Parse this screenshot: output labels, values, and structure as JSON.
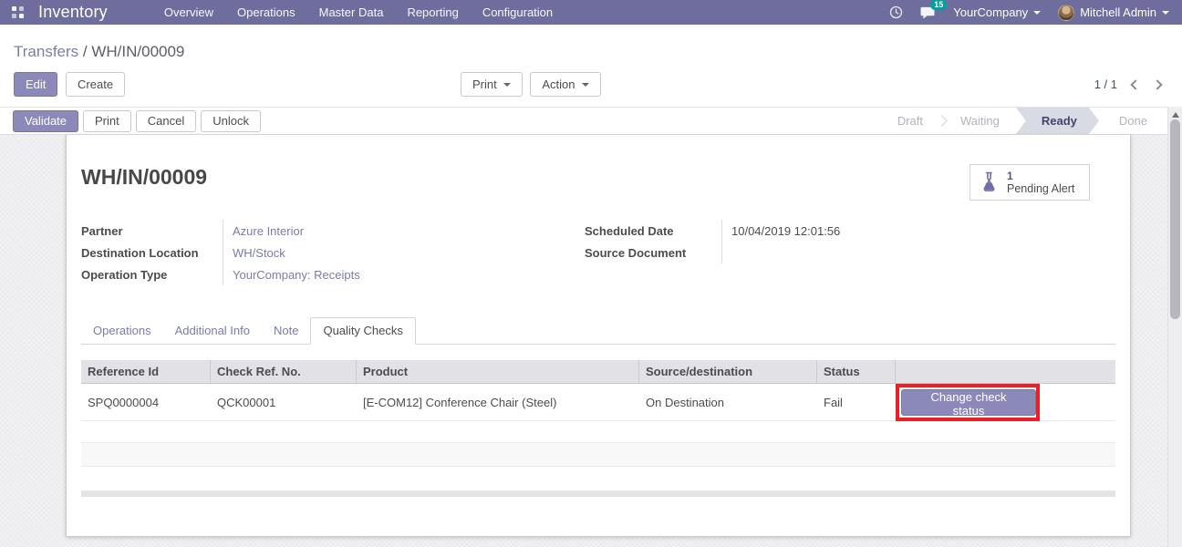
{
  "colors": {
    "navbar_bg": "#6e6d9d",
    "accent_link": "#7c7bad",
    "primary_button": "#8a89ba",
    "messages_badge": "#00a09d",
    "stage_active_bg": "#d8dbe4",
    "annotation_red": "#ed1f24"
  },
  "navbar": {
    "app_name": "Inventory",
    "menu": [
      "Overview",
      "Operations",
      "Master Data",
      "Reporting",
      "Configuration"
    ],
    "messages_badge": "15",
    "company": "YourCompany",
    "user": "Mitchell Admin"
  },
  "control_panel": {
    "breadcrumb": {
      "parent": "Transfers",
      "separator": " / ",
      "current": "WH/IN/00009"
    },
    "edit": "Edit",
    "create": "Create",
    "print": "Print",
    "action": "Action",
    "pager": "1 / 1"
  },
  "statusbar": {
    "buttons": [
      "Validate",
      "Print",
      "Cancel",
      "Unlock"
    ],
    "stages": [
      {
        "label": "Draft",
        "active": false
      },
      {
        "label": "Waiting",
        "active": false
      },
      {
        "label": "Ready",
        "active": true
      },
      {
        "label": "Done",
        "active": false
      }
    ]
  },
  "form": {
    "title": "WH/IN/00009",
    "stat_button": {
      "count": "1",
      "label": "Pending Alert",
      "icon": "flask-icon"
    },
    "fields_left": [
      {
        "label": "Partner",
        "value": "Azure Interior"
      },
      {
        "label": "Destination Location",
        "value": "WH/Stock"
      },
      {
        "label": "Operation Type",
        "value": "YourCompany: Receipts"
      }
    ],
    "fields_right": [
      {
        "label": "Scheduled Date",
        "value": "10/04/2019 12:01:56"
      },
      {
        "label": "Source Document",
        "value": ""
      }
    ],
    "tabs": [
      {
        "label": "Operations",
        "active": false
      },
      {
        "label": "Additional Info",
        "active": false
      },
      {
        "label": "Note",
        "active": false
      },
      {
        "label": "Quality Checks",
        "active": true
      }
    ]
  },
  "quality_table": {
    "columns": [
      "Reference Id",
      "Check Ref. No.",
      "Product",
      "Source/destination",
      "Status"
    ],
    "row": {
      "reference_id": "SPQ0000004",
      "check_ref": "QCK00001",
      "product": "[E-COM12] Conference Chair (Steel)",
      "source_destination": "On Destination",
      "status": "Fail",
      "action_label": "Change check status"
    }
  }
}
